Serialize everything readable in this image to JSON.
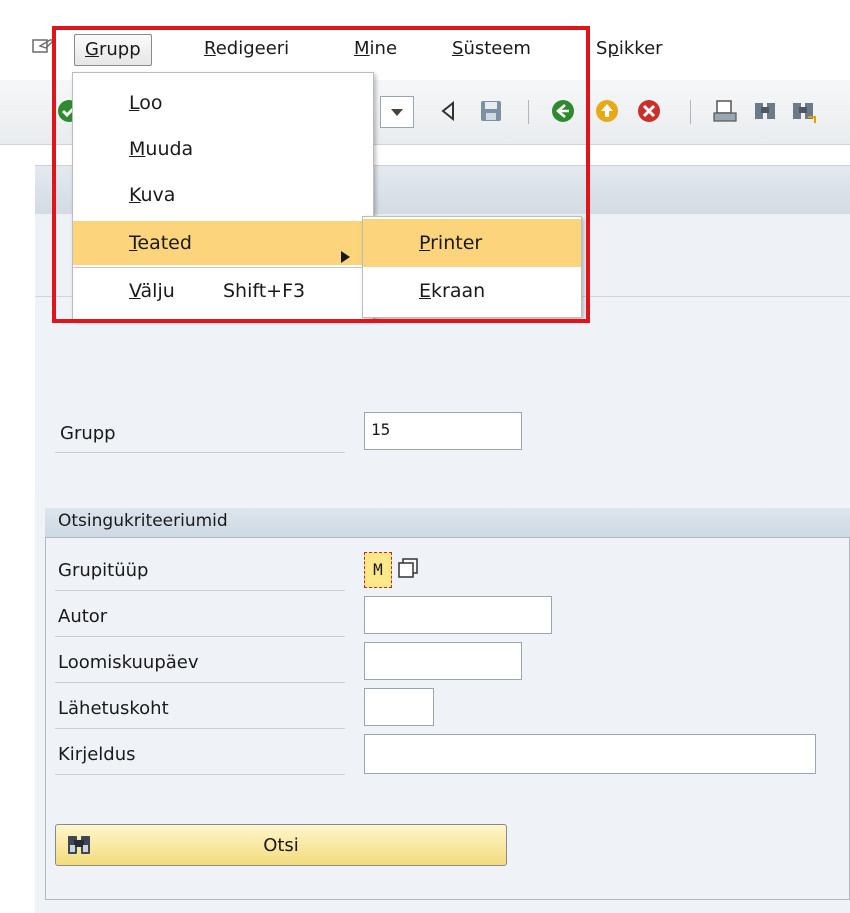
{
  "menubar": {
    "items": [
      {
        "label": "Grupp",
        "underline": "G",
        "rest": "rupp"
      },
      {
        "label": "Redigeeri",
        "underline": "R",
        "rest": "edigeeri"
      },
      {
        "label": "Mine",
        "underline": "M",
        "rest": "ine"
      },
      {
        "label": "Süsteem",
        "underline": "S",
        "rest": "üsteem"
      },
      {
        "label": "Spikker",
        "pre": "S",
        "underline": "p",
        "rest": "ikker"
      }
    ]
  },
  "dropdown": {
    "items": [
      {
        "label": "Loo",
        "underline": "L",
        "rest": "oo"
      },
      {
        "label": "Muuda",
        "underline": "M",
        "rest": "uuda"
      },
      {
        "label": "Kuva",
        "underline": "K",
        "rest": "uva"
      },
      {
        "label": "Teated",
        "underline": "T",
        "rest": "eated"
      },
      {
        "label": "Välju",
        "underline": "V",
        "rest": "älju",
        "shortcut": "Shift+F3"
      }
    ],
    "submenu": [
      {
        "label": "Printer",
        "underline": "P",
        "rest": "rinter"
      },
      {
        "label": "Ekraan",
        "underline": "E",
        "rest": "kraan"
      }
    ]
  },
  "form": {
    "grupp_label": "Grupp",
    "grupp_value": "15",
    "section_title": "Otsingukriteeriumid",
    "fields": [
      {
        "label": "Grupitüüp",
        "value": "M"
      },
      {
        "label": "Autor",
        "value": ""
      },
      {
        "label": "Loomiskuupäev",
        "value": ""
      },
      {
        "label": "Lähetuskoht",
        "value": ""
      },
      {
        "label": "Kirjeldus",
        "value": ""
      }
    ],
    "search_button_label": "Otsi"
  },
  "colors": {
    "highlight_border": "#e0151b",
    "menu_highlight": "#fbd47c",
    "button_yellow": "#f3dc7c"
  },
  "icons": [
    "window-menu-icon",
    "green-check-icon",
    "back-arrow-icon",
    "save-icon",
    "back-circle-icon",
    "exit-circle-icon",
    "cancel-circle-icon",
    "print-icon",
    "find-icon",
    "find-next-icon",
    "binoculars-icon",
    "multiple-selection-icon"
  ]
}
